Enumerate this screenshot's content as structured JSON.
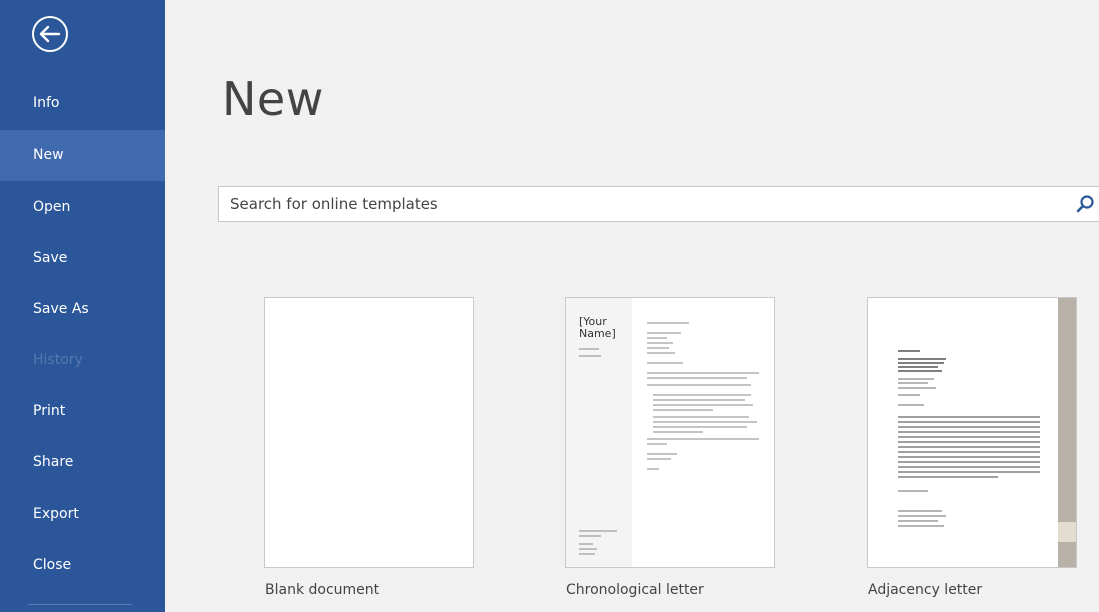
{
  "sidebar": {
    "back": "back-arrow-icon",
    "items": [
      {
        "label": "Info"
      },
      {
        "label": "New"
      },
      {
        "label": "Open"
      },
      {
        "label": "Save"
      },
      {
        "label": "Save As"
      },
      {
        "label": "History"
      },
      {
        "label": "Print"
      },
      {
        "label": "Share"
      },
      {
        "label": "Export"
      },
      {
        "label": "Close"
      }
    ],
    "active": "New",
    "disabled": "History"
  },
  "main": {
    "title": "New",
    "search": {
      "placeholder": "Search for online templates",
      "icon": "search-icon"
    },
    "templates": [
      {
        "label": "Blank document"
      },
      {
        "label": "Chronological letter",
        "thumb_heading": "[Your Name]"
      },
      {
        "label": "Adjacency letter"
      }
    ]
  },
  "colors": {
    "sidebar": "#2b579a",
    "sidebar_active": "#3f6ab0",
    "background": "#f1f1f1"
  }
}
